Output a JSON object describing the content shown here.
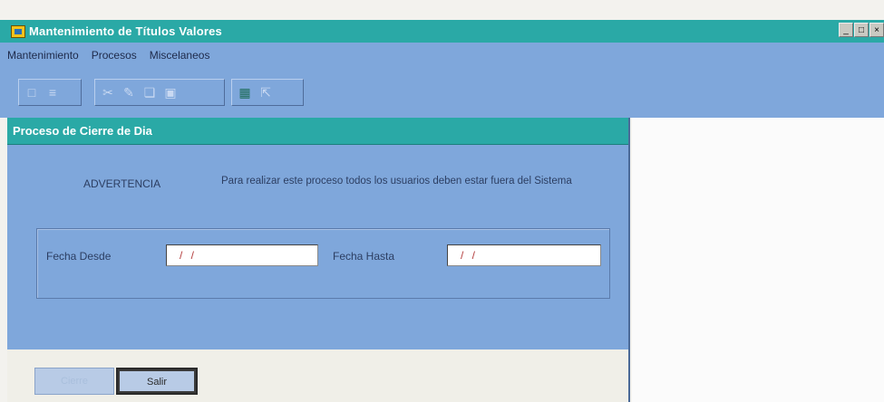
{
  "window": {
    "title": "Mantenimiento de Títulos Valores",
    "controls": [
      "_",
      "□",
      "×"
    ]
  },
  "menu": {
    "items": [
      "Mantenimiento",
      "Procesos",
      "Miscelaneos"
    ]
  },
  "toolbar": {
    "groups": [
      {
        "icons": [
          "new-icon",
          "list-icon"
        ]
      },
      {
        "icons": [
          "cut-icon",
          "edit-icon",
          "copy-icon",
          "save-icon"
        ]
      },
      {
        "icons": [
          "grid-icon",
          "exit-icon"
        ]
      }
    ]
  },
  "panel": {
    "title": "Proceso de Cierre de Dia",
    "warning_label": "ADVERTENCIA",
    "warning_text": "Para realizar este proceso todos los usuarios deben estar fuera del Sistema",
    "fecha_desde_label": "Fecha Desde",
    "fecha_desde_value": "/ /",
    "fecha_hasta_label": "Fecha Hasta",
    "fecha_hasta_value": "/ /",
    "button_left_label": "Cierre",
    "button_exit_label": "Salir"
  }
}
